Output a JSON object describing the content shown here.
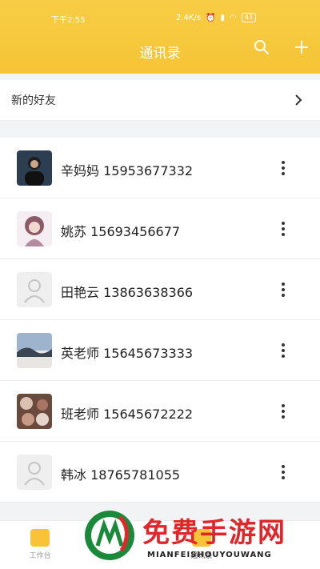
{
  "status": {
    "time": "下午2:55",
    "network": "2.4K/s",
    "battery": "43"
  },
  "header": {
    "title": "通讯录",
    "search_icon": "search-icon",
    "add_icon": "plus-icon"
  },
  "new_friend": {
    "label": "新的好友"
  },
  "contacts": [
    {
      "label": "辛妈妈 15953677332",
      "avatar": "photo-dark"
    },
    {
      "label": "姚苏 15693456677",
      "avatar": "anime"
    },
    {
      "label": "田艳云 13863638366",
      "avatar": "placeholder"
    },
    {
      "label": "英老师 15645673333",
      "avatar": "landscape"
    },
    {
      "label": "班老师 15645672222",
      "avatar": "collage"
    },
    {
      "label": "韩冰 18765781055",
      "avatar": "placeholder"
    }
  ],
  "tabbar": {
    "workbench": "工作台",
    "contacts": "通讯录"
  },
  "watermark": {
    "title": "免费手游网",
    "subtitle": "MIANFEISHOUYOUWANG"
  },
  "colors": {
    "accent": "#f6c436",
    "watermark_red": "#e0262a",
    "watermark_green": "#1a8a3a"
  }
}
